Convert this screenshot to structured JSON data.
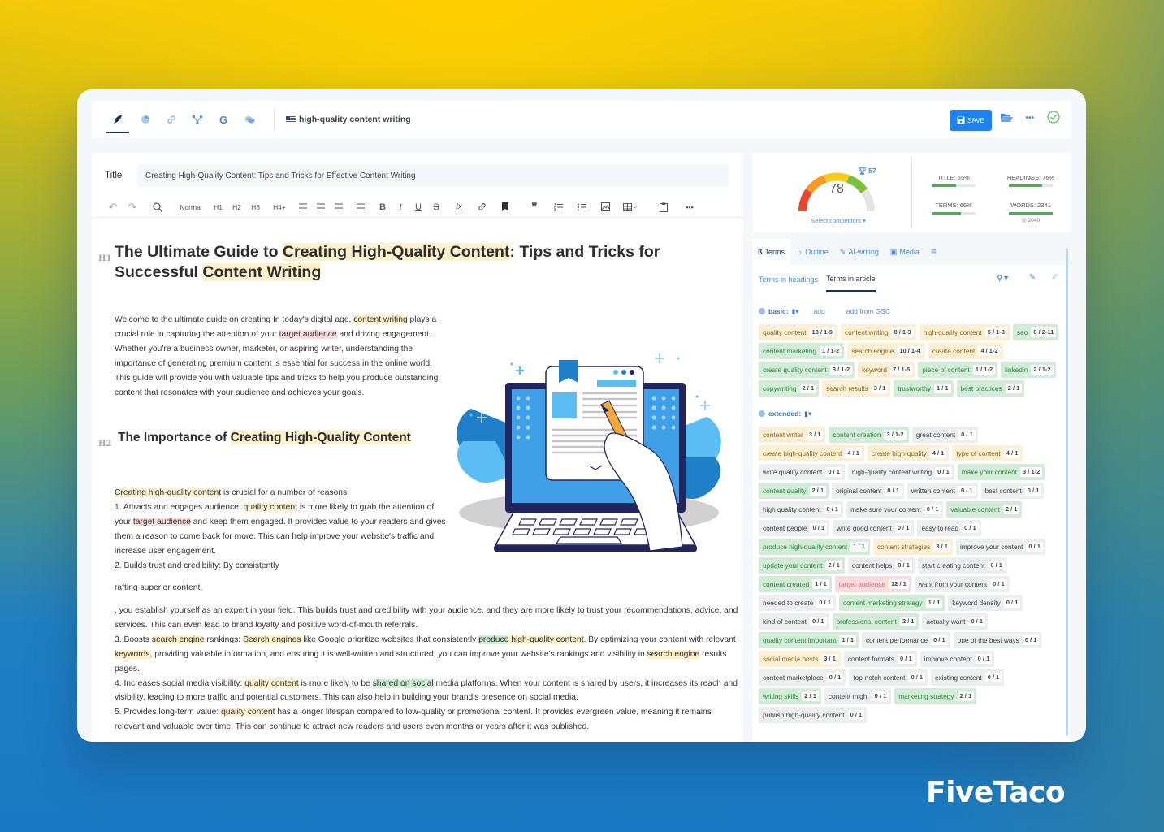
{
  "brand": "FiveTaco",
  "topbar": {
    "icons": [
      "feather-icon",
      "pie-chart-icon",
      "link-icon",
      "sitemap-icon",
      "google-icon",
      "chat-icon"
    ],
    "keyword": "high-quality content writing",
    "save_label": "SAVE",
    "folder_icon": "folder-open-icon",
    "more_icon": "more-icon",
    "check_icon": "check-circle-icon"
  },
  "editor": {
    "title_label": "Title",
    "title_value": "Creating High-Quality Content: Tips and Tricks for Effective Content Writing",
    "toolbar": {
      "undo": "↶",
      "redo": "↷",
      "search": "⚲",
      "normal": "Normal",
      "h1": "H1",
      "h2": "H2",
      "h3": "H3",
      "h4": "H4+",
      "bold": "B",
      "italic": "I",
      "underline": "U",
      "strike": "S",
      "clear": "Ix",
      "quote": "❞",
      "more": "•••"
    },
    "h1_mark": "H1",
    "h1": {
      "p1": "The Ultimate Guide to ",
      "hl1": "Creating High-Quality Content",
      "p2": ": Tips and Tricks for Successful ",
      "hl2": "Content Writing"
    },
    "intro": {
      "p1": "Welcome to the ultimate guide on creating  In today's digital age, ",
      "hl1": "content writing",
      "p2": " plays a crucial role in capturing the attention of your ",
      "hl2": "target audience",
      "p3": " and driving engagement. Whether you're a business owner, marketer, or aspiring writer, understanding the importance of generating premium content is essential for success in the online world. This guide will provide you with valuable tips and tricks to help you produce outstanding content that resonates with your audience and achieves your goals."
    },
    "h2_mark": "H2",
    "h2": {
      "p1": "The Importance of ",
      "hl1": "Creating High-Quality Content"
    },
    "reasons": {
      "hl1": "Creating high-quality content",
      "p1": " is crucial for a number of reasons:",
      "l1a": "1. Attracts and engages audience: ",
      "hl2": "quality content",
      "l1b": " is more likely to grab the attention of your ",
      "hl3": "target audience",
      "l1c": " and keep them engaged. It provides value to your readers and gives them a reason to come back for more. This can help improve your website's traffic and increase user engagement.",
      "l2": "2. Builds trust and credibility: By consistently"
    },
    "fragment": "rafting superior content,",
    "body": {
      "p1": ", you establish yourself as an expert in your field. This builds trust and credibility with your audience, and they are more likely to trust your recommendations, advice, and services. This can even lead to brand loyalty and positive word-of-mouth referrals.",
      "l3a": "3. Boosts ",
      "hl1": "search engine",
      "l3b": " rankings: ",
      "hl2": "Search engines",
      "l3c": " like Google prioritize websites that consistently ",
      "hl3g": "produce",
      "hl3y": " high-quality content",
      "l3d": ". By optimizing your content with relevant ",
      "hl4": "keywords",
      "l3e": ", providing valuable information, and ensuring it is well-written and structured, you can improve your website's rankings and visibility in ",
      "hl5": "search engine",
      "l3f": " results pages.",
      "l4a": "4. Increases social media visibility: ",
      "hl6": "quality content",
      "l4b": " is more likely to be ",
      "hl7": "shared on social",
      "l4c": " media platforms. When your content is shared by users, it increases its reach and visibility, leading to more traffic and potential customers. This can also help in building your brand's presence on social media.",
      "l5a": "5. Provides long-term value: ",
      "hl8": "quality content",
      "l5b": " has a longer lifespan compared to low-quality or promotional content. It provides evergreen value, meaning it remains relevant and valuable over time. This can continue to attract new readers and users even months or years after it was published."
    }
  },
  "score": {
    "value": "78",
    "competitor_score": "57",
    "select_competitors": "Select competitors ▾",
    "stats": [
      {
        "label": "TITLE: 55%",
        "fill": 0.55
      },
      {
        "label": "HEADINGS: 76%",
        "fill": 0.76
      },
      {
        "label": "TERMS: 66%",
        "fill": 0.66
      },
      {
        "label": "WORDS: 2341",
        "fill": 1.0
      }
    ],
    "words_target": "◎ 2040",
    "colors": {
      "red": "#e8472a",
      "orange": "#f39b24",
      "yellow": "#f8cc1b",
      "green": "#7cbf3f",
      "gray": "#e4e4e4"
    }
  },
  "panel": {
    "tabs": [
      {
        "icon": "ß",
        "label": "Terms"
      },
      {
        "icon": "☼",
        "label": "Outline"
      },
      {
        "icon": "✎",
        "label": "AI-writing"
      },
      {
        "icon": "▣",
        "label": "Media"
      }
    ],
    "settings_icon": "≡",
    "subtabs": [
      "Terms in headings",
      "Terms in article"
    ],
    "basic_label": "basic:",
    "add_label": "add",
    "add_gsc_label": "add from GSC",
    "extended_label": "extended:",
    "basic_terms": [
      {
        "t": "quality content",
        "c": "18 / 1-9",
        "s": "y"
      },
      {
        "t": "content writing",
        "c": "8 / 1-3",
        "s": "y"
      },
      {
        "t": "high-quality content",
        "c": "5 / 1-3",
        "s": "y"
      },
      {
        "t": "seo",
        "c": "8 / 2-11",
        "s": "g"
      },
      {
        "t": "content marketing",
        "c": "1 / 1-2",
        "s": "g"
      },
      {
        "t": "search engine",
        "c": "10 / 1-4",
        "s": "y"
      },
      {
        "t": "create content",
        "c": "4 / 1-2",
        "s": "y"
      },
      {
        "t": "create quality content",
        "c": "3 / 1-2",
        "s": "g"
      },
      {
        "t": "keyword",
        "c": "7 / 1-5",
        "s": "y"
      },
      {
        "t": "piece of content",
        "c": "1 / 1-2",
        "s": "g"
      },
      {
        "t": "linkedin",
        "c": "2 / 1-2",
        "s": "g"
      },
      {
        "t": "copywriting",
        "c": "2 / 1",
        "s": "g"
      },
      {
        "t": "search results",
        "c": "3 / 1",
        "s": "y"
      },
      {
        "t": "trustworthy",
        "c": "1 / 1",
        "s": "g"
      },
      {
        "t": "best practices",
        "c": "2 / 1",
        "s": "g"
      }
    ],
    "extended_terms": [
      {
        "t": "content writer",
        "c": "3 / 1",
        "s": "y"
      },
      {
        "t": "content creation",
        "c": "3 / 1-2",
        "s": "g"
      },
      {
        "t": "great content",
        "c": "0 / 1",
        "s": "n"
      },
      {
        "t": "create high-quality content",
        "c": "4 / 1",
        "s": "y"
      },
      {
        "t": "create high-quality",
        "c": "4 / 1",
        "s": "y"
      },
      {
        "t": "type of content",
        "c": "4 / 1",
        "s": "y"
      },
      {
        "t": "write quality content",
        "c": "0 / 1",
        "s": "n"
      },
      {
        "t": "high-quality content writing",
        "c": "0 / 1",
        "s": "n"
      },
      {
        "t": "make your content",
        "c": "3 / 1-2",
        "s": "g"
      },
      {
        "t": "content quality",
        "c": "2 / 1",
        "s": "g"
      },
      {
        "t": "original content",
        "c": "0 / 1",
        "s": "n"
      },
      {
        "t": "written content",
        "c": "0 / 1",
        "s": "n"
      },
      {
        "t": "best content",
        "c": "0 / 1",
        "s": "n"
      },
      {
        "t": "high quality content",
        "c": "0 / 1",
        "s": "n"
      },
      {
        "t": "make sure your content",
        "c": "0 / 1",
        "s": "n"
      },
      {
        "t": "valuable content",
        "c": "2 / 1",
        "s": "g"
      },
      {
        "t": "content people",
        "c": "0 / 1",
        "s": "n"
      },
      {
        "t": "write good content",
        "c": "0 / 1",
        "s": "n"
      },
      {
        "t": "easy to read",
        "c": "0 / 1",
        "s": "n"
      },
      {
        "t": "produce high-quality content",
        "c": "1 / 1",
        "s": "g"
      },
      {
        "t": "content strategies",
        "c": "3 / 1",
        "s": "y"
      },
      {
        "t": "improve your content",
        "c": "0 / 1",
        "s": "n"
      },
      {
        "t": "update your content",
        "c": "2 / 1",
        "s": "g"
      },
      {
        "t": "content helps",
        "c": "0 / 1",
        "s": "n"
      },
      {
        "t": "start creating content",
        "c": "0 / 1",
        "s": "n"
      },
      {
        "t": "content created",
        "c": "1 / 1",
        "s": "g"
      },
      {
        "t": "target audience",
        "c": "12 / 1",
        "s": "r"
      },
      {
        "t": "want from your content",
        "c": "0 / 1",
        "s": "n"
      },
      {
        "t": "needed to create",
        "c": "0 / 1",
        "s": "n"
      },
      {
        "t": "content marketing strategy",
        "c": "1 / 1",
        "s": "g"
      },
      {
        "t": "keyword density",
        "c": "0 / 1",
        "s": "n"
      },
      {
        "t": "kind of content",
        "c": "0 / 1",
        "s": "n"
      },
      {
        "t": "professional content",
        "c": "2 / 1",
        "s": "g"
      },
      {
        "t": "actually want",
        "c": "0 / 1",
        "s": "n"
      },
      {
        "t": "quality content important",
        "c": "1 / 1",
        "s": "g"
      },
      {
        "t": "content performance",
        "c": "0 / 1",
        "s": "n"
      },
      {
        "t": "one of the best ways",
        "c": "0 / 1",
        "s": "n"
      },
      {
        "t": "social media posts",
        "c": "3 / 1",
        "s": "y"
      },
      {
        "t": "content formats",
        "c": "0 / 1",
        "s": "n"
      },
      {
        "t": "improve content",
        "c": "0 / 1",
        "s": "n"
      },
      {
        "t": "content marketplace",
        "c": "0 / 1",
        "s": "n"
      },
      {
        "t": "top-notch content",
        "c": "0 / 1",
        "s": "n"
      },
      {
        "t": "existing content",
        "c": "0 / 1",
        "s": "n"
      },
      {
        "t": "writing skills",
        "c": "2 / 1",
        "s": "g"
      },
      {
        "t": "content might",
        "c": "0 / 1",
        "s": "n"
      },
      {
        "t": "marketing strategy",
        "c": "2 / 1",
        "s": "g"
      },
      {
        "t": "publish high-quality content",
        "c": "0 / 1",
        "s": "n"
      }
    ]
  }
}
